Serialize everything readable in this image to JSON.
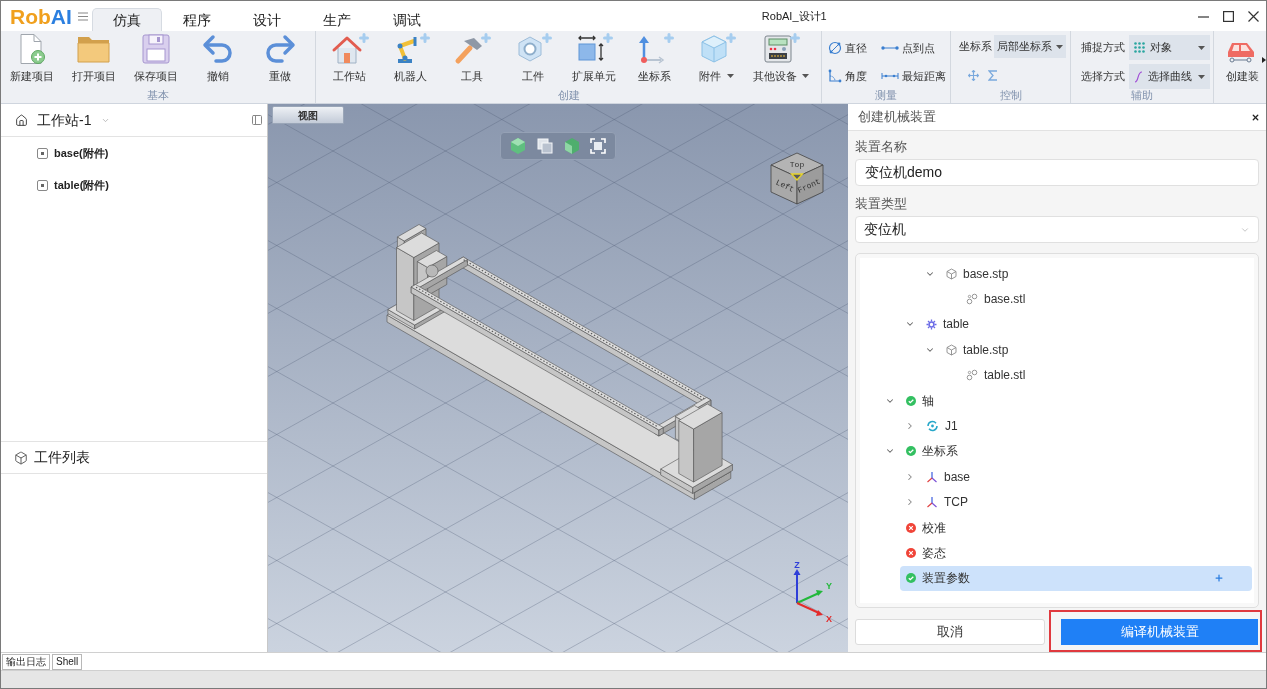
{
  "title_bar": {
    "logo": [
      "Rob",
      "AI"
    ],
    "tabs": [
      {
        "label": "仿真",
        "selected": true
      },
      {
        "label": "程序",
        "selected": false
      },
      {
        "label": "设计",
        "selected": false
      },
      {
        "label": "生产",
        "selected": false
      },
      {
        "label": "调试",
        "selected": false
      }
    ],
    "title": "RobAI_设计1"
  },
  "ribbon": {
    "groups": [
      {
        "kind": "large",
        "title": "基本",
        "buttons": [
          {
            "label": "新建项目",
            "has_menu": false
          },
          {
            "label": "打开项目",
            "has_menu": false
          },
          {
            "label": "保存项目",
            "has_menu": false
          },
          {
            "label": "撤销",
            "has_menu": false
          },
          {
            "label": "重做",
            "has_menu": false
          }
        ]
      },
      {
        "kind": "large",
        "title": "创建",
        "buttons": [
          {
            "label": "工作站",
            "has_menu": false
          },
          {
            "label": "机器人",
            "has_menu": false
          },
          {
            "label": "工具",
            "has_menu": false
          },
          {
            "label": "工件",
            "has_menu": false
          },
          {
            "label": "扩展单元",
            "has_menu": false
          },
          {
            "label": "坐标系",
            "has_menu": false
          },
          {
            "label": "附件",
            "has_menu": true
          },
          {
            "label": "其他设备",
            "has_menu": true
          }
        ]
      },
      {
        "kind": "measure",
        "title": "测量",
        "tools": [
          "直径",
          "点到点",
          "角度",
          "最短距离"
        ]
      },
      {
        "kind": "control",
        "title": "控制",
        "field_label": "坐标系",
        "value": "局部坐标系"
      },
      {
        "kind": "assist",
        "title": "辅助",
        "selects": [
          {
            "label": "捕捉方式",
            "value": "对象"
          },
          {
            "label": "选择方式",
            "value": "选择曲线"
          }
        ]
      },
      {
        "kind": "large",
        "buttons": [
          {
            "label": "创建装",
            "has_menu": false
          }
        ]
      }
    ]
  },
  "workstation_panel": {
    "title": "工作站-1",
    "items": [
      "base(附件)",
      "table(附件)"
    ]
  },
  "parts_panel": {
    "title": "工件列表"
  },
  "viewport": {
    "tab": "视图",
    "view_cube": {
      "top": "Top",
      "left": "Left",
      "front": "Front"
    },
    "axes": {
      "z": "Z",
      "y": "Y",
      "x": "X"
    }
  },
  "device_panel": {
    "title": "创建机械装置",
    "name_label": "装置名称",
    "name_value": "变位机demo",
    "type_label": "装置类型",
    "type_value": "变位机",
    "tree": [
      {
        "children": [
          {
            "children": [
              {
                "kind": "part",
                "label": "base.stp",
                "expanded": true,
                "selected": false,
                "children": [
                  {
                    "kind": "mesh",
                    "label": "base.stl",
                    "selected": false
                  }
                ]
              }
            ]
          },
          {
            "kind": "link",
            "label": "table",
            "expanded": true,
            "selected": false,
            "children": [
              {
                "kind": "part",
                "label": "table.stp",
                "expanded": true,
                "selected": false,
                "children": [
                  {
                    "kind": "mesh",
                    "label": "table.stl",
                    "selected": false
                  }
                ]
              }
            ]
          }
        ]
      },
      {
        "kind": "group",
        "label": "轴",
        "valid": true,
        "expanded": true,
        "selected": false,
        "children": [
          {
            "kind": "joint",
            "label": "J1",
            "expanded": false,
            "selected": false
          }
        ]
      },
      {
        "kind": "group",
        "label": "坐标系",
        "valid": true,
        "expanded": true,
        "selected": false,
        "children": [
          {
            "kind": "frame",
            "label": "base",
            "expanded": false,
            "selected": false
          },
          {
            "kind": "frame",
            "label": "TCP",
            "expanded": false,
            "selected": false
          }
        ]
      },
      {
        "kind": "group",
        "label": "校准",
        "valid": false,
        "selected": false
      },
      {
        "kind": "group",
        "label": "姿态",
        "valid": false,
        "selected": false
      },
      {
        "kind": "group",
        "label": "装置参数",
        "valid": true,
        "selected": true
      }
    ],
    "cancel": "取消",
    "submit": "编译机械装置"
  },
  "output_tabs": [
    "输出日志",
    "Shell"
  ]
}
